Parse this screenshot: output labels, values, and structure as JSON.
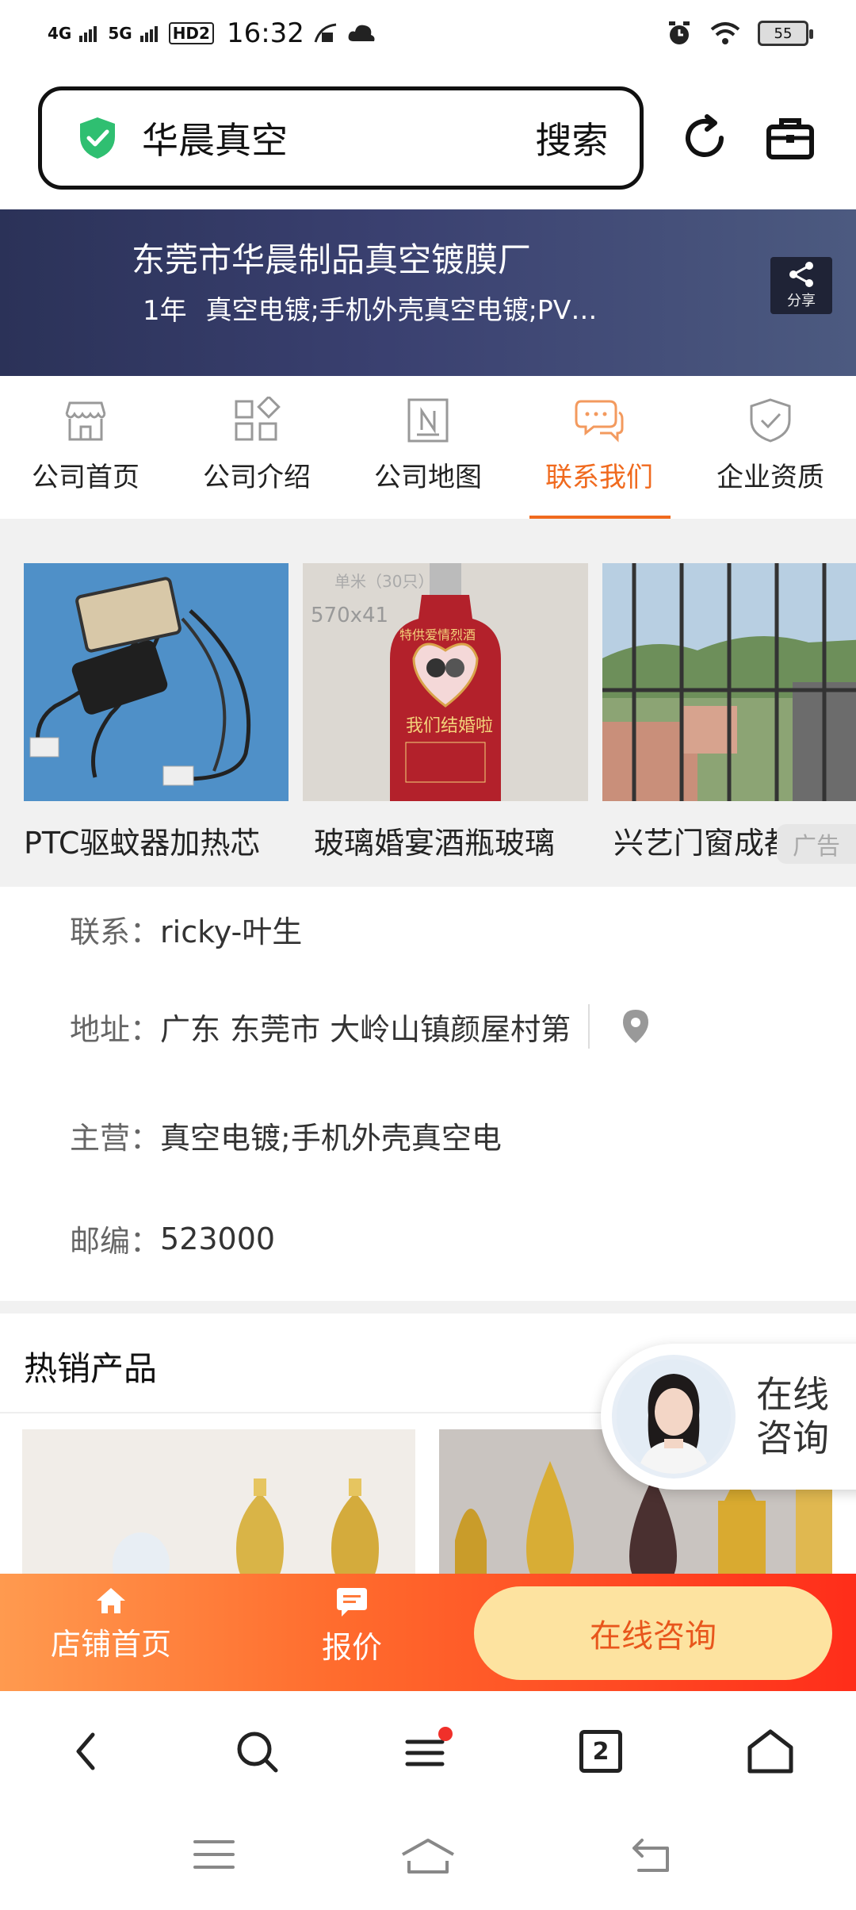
{
  "status_bar": {
    "signal1": "4G",
    "signal2": "5G",
    "hd": "HD2",
    "time": "16:32",
    "battery": "55"
  },
  "search": {
    "query": "华晨真空",
    "button_label": "搜索"
  },
  "banner": {
    "company_name": "东莞市华晨制品真空镀膜厂",
    "years": "1年",
    "business": "真空电镀;手机外壳真空电镀;PV…",
    "share_label": "分享"
  },
  "tabs": [
    {
      "label": "公司首页",
      "icon": "store-icon"
    },
    {
      "label": "公司介绍",
      "icon": "grid-icon"
    },
    {
      "label": "公司地图",
      "icon": "map-n-icon"
    },
    {
      "label": "联系我们",
      "icon": "chat-bubbles-icon",
      "active": true
    },
    {
      "label": "企业资质",
      "icon": "shield-check-icon"
    }
  ],
  "carousel": {
    "products": [
      {
        "title": "PTC驱蚊器加热芯"
      },
      {
        "title": "玻璃婚宴酒瓶玻璃"
      },
      {
        "title": "兴艺门窗成都儿童"
      }
    ],
    "ad_label": "广告",
    "product2_box_text": "570x41",
    "product2_box_text2": "单米（30只）",
    "bottle_text": "特供爱情烈酒",
    "bottle_text2": "我们结婚啦"
  },
  "contact": {
    "contact_key": "联系：",
    "contact_value": "ricky-叶生",
    "address_key": "地址：",
    "address_value": "广东 东莞市 大岭山镇颜屋村第",
    "main_key": "主营：",
    "main_value": "真空电镀;手机外壳真空电",
    "zip_key": "邮编：",
    "zip_value": "523000"
  },
  "hot": {
    "title": "热销产品"
  },
  "float_consult": {
    "line1": "在线",
    "line2": "咨询"
  },
  "shop_bar": {
    "home_label": "店铺首页",
    "quote_label": "报价",
    "consult_label": "在线咨询"
  },
  "browser_nav": {
    "tab_count": "2"
  },
  "colors": {
    "accent": "#f06a1e",
    "banner": "#2b3258",
    "shield_green": "#2fbf71"
  }
}
